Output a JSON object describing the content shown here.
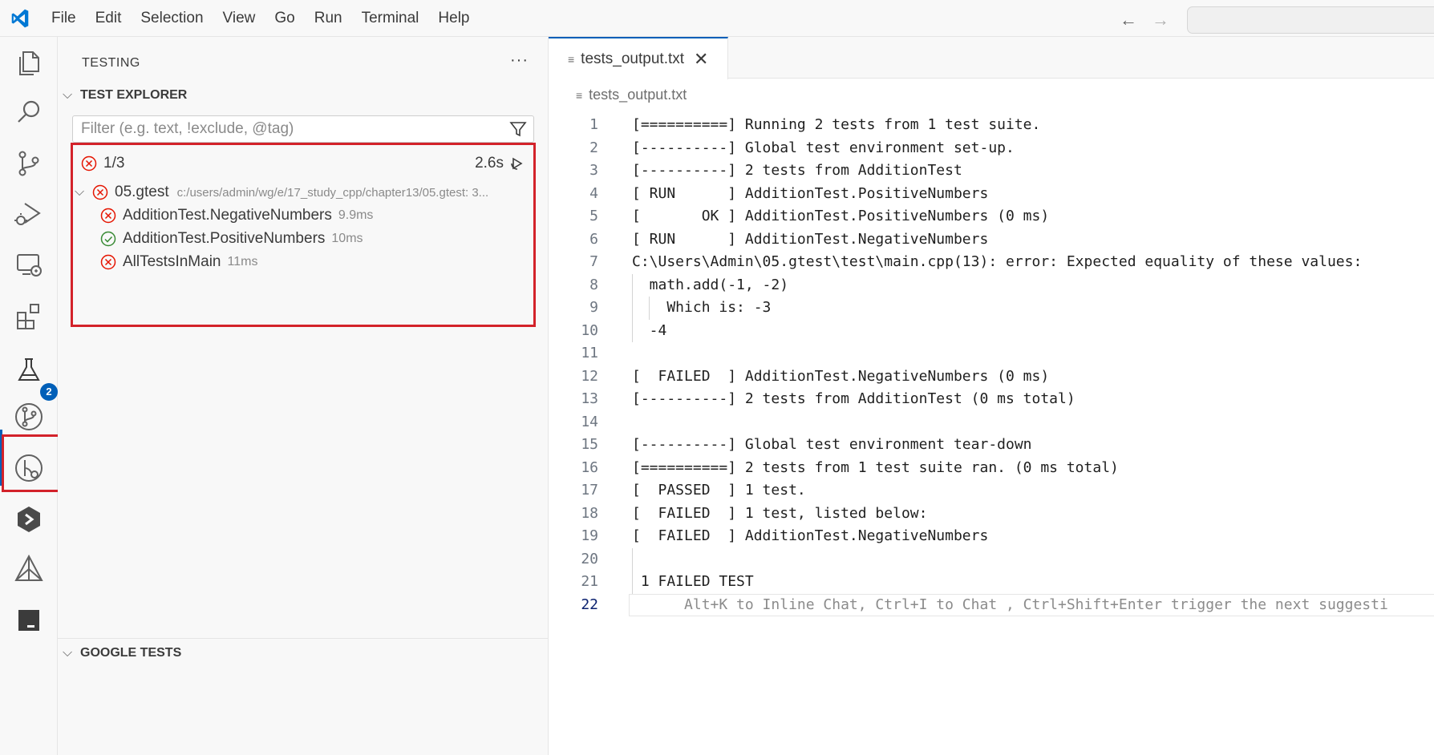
{
  "menu": [
    "File",
    "Edit",
    "Selection",
    "View",
    "Go",
    "Run",
    "Terminal",
    "Help"
  ],
  "activity_bar": {
    "icons": [
      "explorer-icon",
      "search-icon",
      "source-control-icon",
      "run-debug-icon",
      "remote-explorer-icon",
      "extensions-icon",
      "testing-icon",
      "git-graph-icon",
      "timeline-icon",
      "pieces-icon",
      "cmake-icon",
      "panel-icon"
    ],
    "testing_badge": "2"
  },
  "sidebar": {
    "title": "TESTING",
    "more": "···",
    "test_explorer": {
      "heading": "TEST EXPLORER",
      "filter_placeholder": "Filter (e.g. text, !exclude, @tag)",
      "summary": {
        "count": "1/3",
        "duration": "2.6s"
      },
      "suite": {
        "name": "05.gtest",
        "path": "c:/users/admin/wg/e/17_study_cpp/chapter13/05.gtest: 3...",
        "status": "failed"
      },
      "tests": [
        {
          "name": "AdditionTest.NegativeNumbers",
          "duration": "9.9ms",
          "status": "failed"
        },
        {
          "name": "AdditionTest.PositiveNumbers",
          "duration": "10ms",
          "status": "passed"
        },
        {
          "name": "AllTestsInMain",
          "duration": "11ms",
          "status": "failed"
        }
      ]
    },
    "google_tests": {
      "heading": "GOOGLE TESTS"
    }
  },
  "editor": {
    "tab_label": "tests_output.txt",
    "breadcrumb": "tests_output.txt",
    "lines": [
      {
        "n": "1",
        "text": "[==========] Running 2 tests from 1 test suite."
      },
      {
        "n": "2",
        "text": "[----------] Global test environment set-up."
      },
      {
        "n": "3",
        "text": "[----------] 2 tests from AdditionTest"
      },
      {
        "n": "4",
        "text": "[ RUN      ] AdditionTest.PositiveNumbers"
      },
      {
        "n": "5",
        "text": "[       OK ] AdditionTest.PositiveNumbers (0 ms)"
      },
      {
        "n": "6",
        "text": "[ RUN      ] AdditionTest.NegativeNumbers"
      },
      {
        "n": "7",
        "text": "C:\\Users\\Admin\\05.gtest\\test\\main.cpp(13): error: Expected equality of these values:"
      },
      {
        "n": "8",
        "text": "  math.add(-1, -2)"
      },
      {
        "n": "9",
        "text": "    Which is: -3"
      },
      {
        "n": "10",
        "text": "  -4"
      },
      {
        "n": "11",
        "text": ""
      },
      {
        "n": "12",
        "text": "[  FAILED  ] AdditionTest.NegativeNumbers (0 ms)"
      },
      {
        "n": "13",
        "text": "[----------] 2 tests from AdditionTest (0 ms total)"
      },
      {
        "n": "14",
        "text": ""
      },
      {
        "n": "15",
        "text": "[----------] Global test environment tear-down"
      },
      {
        "n": "16",
        "text": "[==========] 2 tests from 1 test suite ran. (0 ms total)"
      },
      {
        "n": "17",
        "text": "[  PASSED  ] 1 test."
      },
      {
        "n": "18",
        "text": "[  FAILED  ] 1 test, listed below:"
      },
      {
        "n": "19",
        "text": "[  FAILED  ] AdditionTest.NegativeNumbers"
      },
      {
        "n": "20",
        "text": ""
      },
      {
        "n": "21",
        "text": " 1 FAILED TEST"
      },
      {
        "n": "22",
        "text": "      Alt+K to Inline Chat, Ctrl+I to Chat , Ctrl+Shift+Enter trigger the next suggesti"
      }
    ]
  },
  "colors": {
    "accent": "#005fb8",
    "highlight_box": "#d3222a",
    "fail": "#e51400",
    "pass": "#388a34"
  }
}
